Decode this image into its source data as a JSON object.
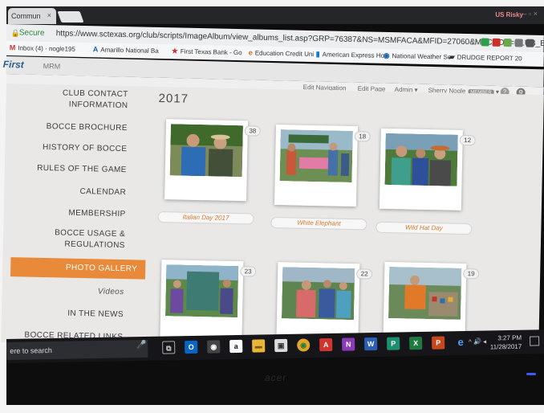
{
  "browser": {
    "tab_title": "Commun",
    "tab_close": "×",
    "profile": "US Risky",
    "window_controls": "–  ▫  ×",
    "secure_label": "Secure",
    "url": "https://www.sctexas.org/club/scripts/ImageAlbum/view_albums_list.asp?GRP=76387&NS=MSMFACA&MFID=27060&MFCODE=CLUB_BOCC...",
    "bookmarks": [
      {
        "icon": "M",
        "label": "Inbox (4) · nogle195",
        "color": "#c9302c"
      },
      {
        "icon": "A",
        "label": "Amarillo National Ba",
        "color": "#1b5fa8"
      },
      {
        "icon": "★",
        "label": "First Texas Bank - Go",
        "color": "#c9302c"
      },
      {
        "icon": "e",
        "label": "Education Credit Uni",
        "color": "#d56a1f"
      },
      {
        "icon": "▮",
        "label": "American Express Ho",
        "color": "#1b78c9"
      },
      {
        "icon": "◉",
        "label": "National Weather Se",
        "color": "#1b5fa8"
      },
      {
        "icon": "▰",
        "label": "DRUDGE REPORT 20",
        "color": "#333333"
      }
    ]
  },
  "site": {
    "logo": "First",
    "sub_logo": "MRM",
    "admin": {
      "edit_navigation": "Edit Navigation",
      "edit_page": "Edit Page",
      "admin_menu": "Admin ▾",
      "user": "Sherry Nogle",
      "user_badge": "MEMBER",
      "user_caret": "▾",
      "help": "?",
      "settings": "⚙"
    }
  },
  "sidebar": {
    "items": [
      {
        "label": "CLUB CONTACT\nINFORMATION"
      },
      {
        "label": "BOCCE BROCHURE"
      },
      {
        "label": "HISTORY OF BOCCE"
      },
      {
        "label": "RULES OF THE GAME"
      },
      {
        "label": "CALENDAR"
      },
      {
        "label": "MEMBERSHIP"
      },
      {
        "label": "BOCCE USAGE &\nREGULATIONS"
      },
      {
        "label": "PHOTO GALLERY"
      },
      {
        "label": "Videos"
      },
      {
        "label": "IN THE NEWS"
      },
      {
        "label": "BOCCE RELATED LINKS"
      }
    ]
  },
  "gallery": {
    "year": "2017",
    "albums": [
      {
        "caption": "Italian Day 2017",
        "count": "38"
      },
      {
        "caption": "White Elephant",
        "count": "18"
      },
      {
        "caption": "Wild Hat Day",
        "count": "12"
      },
      {
        "caption": "",
        "count": "23"
      },
      {
        "caption": "",
        "count": "22"
      },
      {
        "caption": "",
        "count": "19"
      }
    ]
  },
  "taskbar": {
    "search_placeholder": "ere to search",
    "mic": "🎤",
    "time": "3:27 PM",
    "date": "11/28/2017",
    "tray": "^ 🔊 ◂",
    "apps": [
      {
        "name": "task-view",
        "glyph": "⧉",
        "color": "#16161a"
      },
      {
        "name": "outlook",
        "glyph": "O",
        "color": "#0a64c8"
      },
      {
        "name": "photos",
        "glyph": "◉",
        "color": "#444444"
      },
      {
        "name": "amazon",
        "glyph": "a",
        "color": "#ffffff"
      },
      {
        "name": "file-explorer",
        "glyph": "▬",
        "color": "#e8b73a"
      },
      {
        "name": "store",
        "glyph": "▣",
        "color": "#dddddd"
      },
      {
        "name": "chrome",
        "glyph": "◉",
        "color": "#e2a42b"
      },
      {
        "name": "acrobat",
        "glyph": "A",
        "color": "#d0342c"
      },
      {
        "name": "onenote",
        "glyph": "N",
        "color": "#8a3bb8"
      },
      {
        "name": "word",
        "glyph": "W",
        "color": "#2b5fb4"
      },
      {
        "name": "publisher",
        "glyph": "P",
        "color": "#1d8f6e"
      },
      {
        "name": "excel",
        "glyph": "X",
        "color": "#1e7a3f"
      },
      {
        "name": "powerpoint",
        "glyph": "P",
        "color": "#c8481e"
      },
      {
        "name": "edge",
        "glyph": "e",
        "color": "#1a73c9"
      }
    ]
  },
  "bezel": {
    "brand": "acer"
  }
}
